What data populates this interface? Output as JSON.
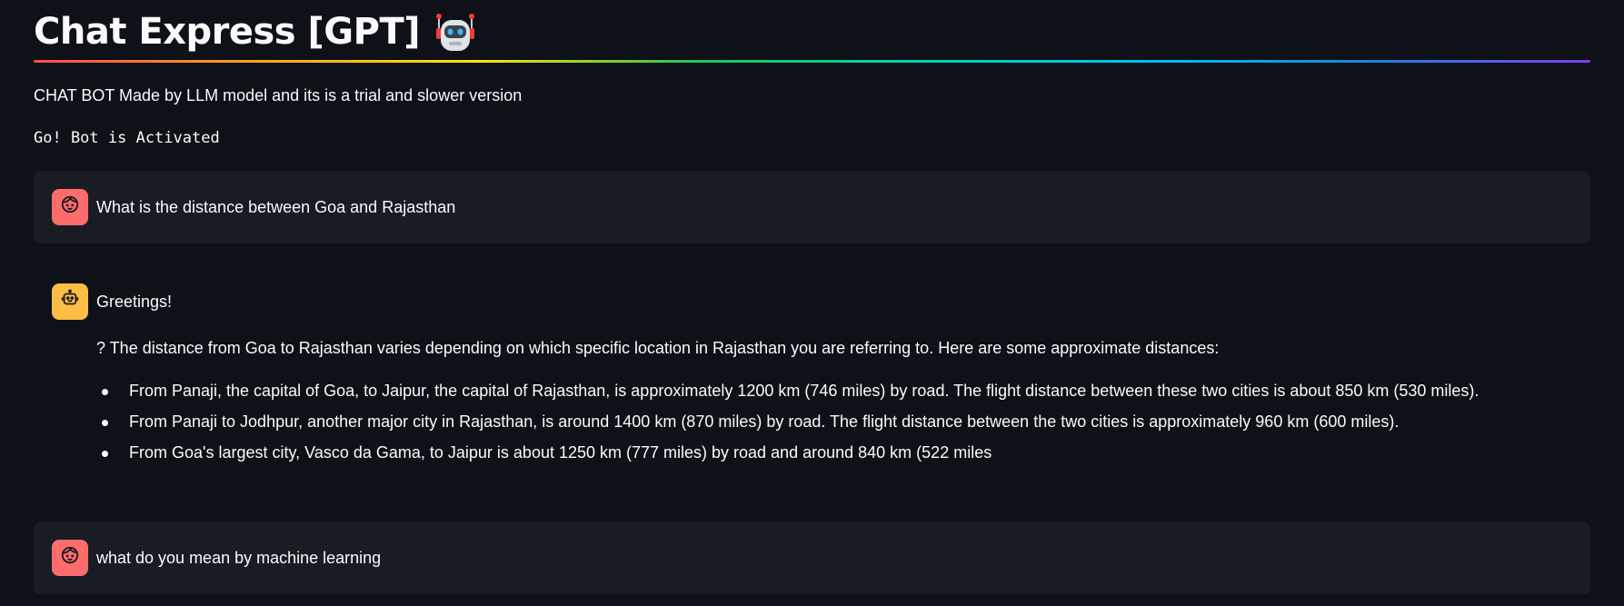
{
  "app": {
    "title": "Chat Express [GPT]",
    "title_icon": "robot-emoji",
    "subtitle": "CHAT BOT Made by LLM model and its is a trial and slower version",
    "status": "Go! Bot is Activated"
  },
  "colors": {
    "background": "#0e1117",
    "user_bubble": "#1a1c24",
    "user_avatar": "#ff6c6c",
    "assistant_avatar": "#ffbd45",
    "text": "#fafafa"
  },
  "messages": [
    {
      "role": "user",
      "avatar_icon": "face-icon",
      "text": "What is the distance between Goa and Rajasthan"
    },
    {
      "role": "assistant",
      "avatar_icon": "bot-icon",
      "greeting": "Greetings!",
      "paragraph": "? The distance from Goa to Rajasthan varies depending on which specific location in Rajasthan you are referring to. Here are some approximate distances:",
      "bullets": [
        "From Panaji, the capital of Goa, to Jaipur, the capital of Rajasthan, is approximately 1200 km (746 miles) by road. The flight distance between these two cities is about 850 km (530 miles).",
        "From Panaji to Jodhpur, another major city in Rajasthan, is around 1400 km (870 miles) by road. The flight distance between the two cities is approximately 960 km (600 miles).",
        "From Goa's largest city, Vasco da Gama, to Jaipur is about 1250 km (777 miles) by road and around 840 km (522 miles"
      ]
    },
    {
      "role": "user",
      "avatar_icon": "face-icon",
      "text": "what do you mean by machine learning"
    }
  ]
}
